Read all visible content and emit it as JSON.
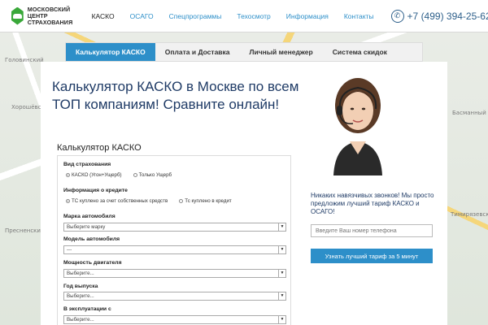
{
  "header": {
    "logo_line1": "МОСКОВСКИЙ",
    "logo_line2": "ЦЕНТР СТРАХОВАНИЯ",
    "nav": [
      "КАСКО",
      "ОСАГО",
      "Спецпрограммы",
      "Техосмотр",
      "Информация",
      "Контакты"
    ],
    "phone": "+7 (499) 394-25-62"
  },
  "map_labels": [
    "Хорошёвский",
    "Пресненский",
    "Басманный",
    "Головинский",
    "Тимирязевский"
  ],
  "tabs": [
    "Калькулятор КАСКО",
    "Оплата и Доставка",
    "Личный менеджер",
    "Система скидок"
  ],
  "headline": "Калькулятор КАСКО в Москве по всем ТОП компаниям! Сравните онлайн!",
  "promo": {
    "text": "Никаких навязчивых звонков! Мы просто предложим лучший тариф КАСКО и ОСАГО!",
    "phone_placeholder": "Введите Ваш номер телефона",
    "button": "Узнать лучший тариф за 5 минут"
  },
  "calculator": {
    "title": "Калькулятор КАСКО",
    "insurance_type_label": "Вид страхования",
    "insurance_type_options": [
      "КАСКО (Угон+Ущерб)",
      "Только Ущерб"
    ],
    "credit_label": "Информация о кредите",
    "credit_options": [
      "ТС куплено за счет собственных средств",
      "Тс куплено в кредит"
    ],
    "brand_label": "Марка автомобиля",
    "brand_value": "Выберите марку",
    "model_label": "Модель автомобиля",
    "model_value": "---",
    "power_label": "Мощность двигателя",
    "power_value": "Выберите...",
    "year_label": "Год выпуска",
    "year_value": "Выберите...",
    "since_label": "В эксплуатации с",
    "since_value": "Выберите..."
  },
  "colors": {
    "accent": "#2d8fc9",
    "logo_green": "#3aa83a",
    "headline": "#1f3b66"
  }
}
